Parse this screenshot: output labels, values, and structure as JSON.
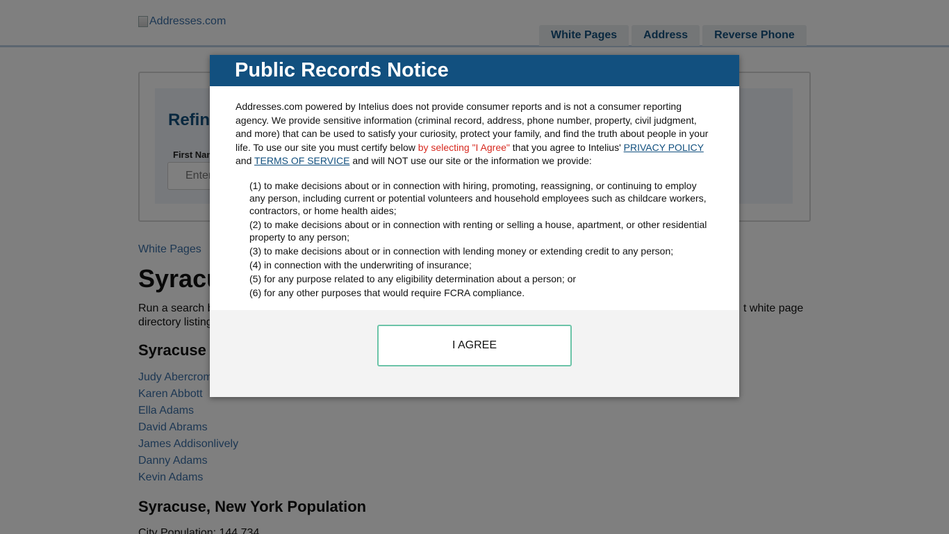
{
  "header": {
    "logo_text": "Addresses.com",
    "nav": [
      "White Pages",
      "Address",
      "Reverse Phone"
    ]
  },
  "refine": {
    "title": "Refine",
    "first_name_label": "First Nam",
    "first_name_placeholder": "Enter"
  },
  "main": {
    "breadcrumb": "White Pages",
    "title": "Syracuse",
    "intro_start": "Run a search b",
    "intro_end": "t white page",
    "intro_line2": "directory listing",
    "residents_title": "Syracuse",
    "names": [
      "Judy Abercrom",
      "Karen Abbott",
      "Ella Adams",
      "David Abrams",
      "James Addisonlively",
      "Danny Adams",
      "Kevin Adams"
    ],
    "population_title": "Syracuse, New York Population",
    "population_line": "City Population: 144,734"
  },
  "modal": {
    "title": "Public Records Notice",
    "p1": "Addresses.com powered by Intelius does not provide consumer reports and is not a consumer reporting agency. We provide sensitive information (criminal record, address, phone number, property, civil judgment, and more) that can be used to satisfy your curiosity, protect your family, and find the truth about people in your life. To use our site you must certify below ",
    "p1_highlight": "by selecting \"I Agree\"",
    "p1_after": " that you agree to Intelius' ",
    "privacy_link": "PRIVACY POLICY",
    "and_text": "and",
    "tos_link": "TERMS OF SERVICE",
    "p1_end": " and will NOT use our site or the information we provide:",
    "items": [
      "(1) to make decisions about or in connection with hiring, promoting, reassigning, or continuing to employ any person, including current or potential volunteers and household employees such as childcare workers, contractors, or home health aides;",
      "(2) to make decisions about or in connection with renting or selling a house, apartment, or other residential property to any person;",
      "(3) to make decisions about or in connection with lending money or extending credit to any person;",
      "(4) in connection with the underwriting of insurance;",
      "(5) for any purpose related to any eligibility determination about a person; or",
      "(6) for any other purposes that would require FCRA compliance."
    ],
    "agree_label": "I AGREE"
  }
}
